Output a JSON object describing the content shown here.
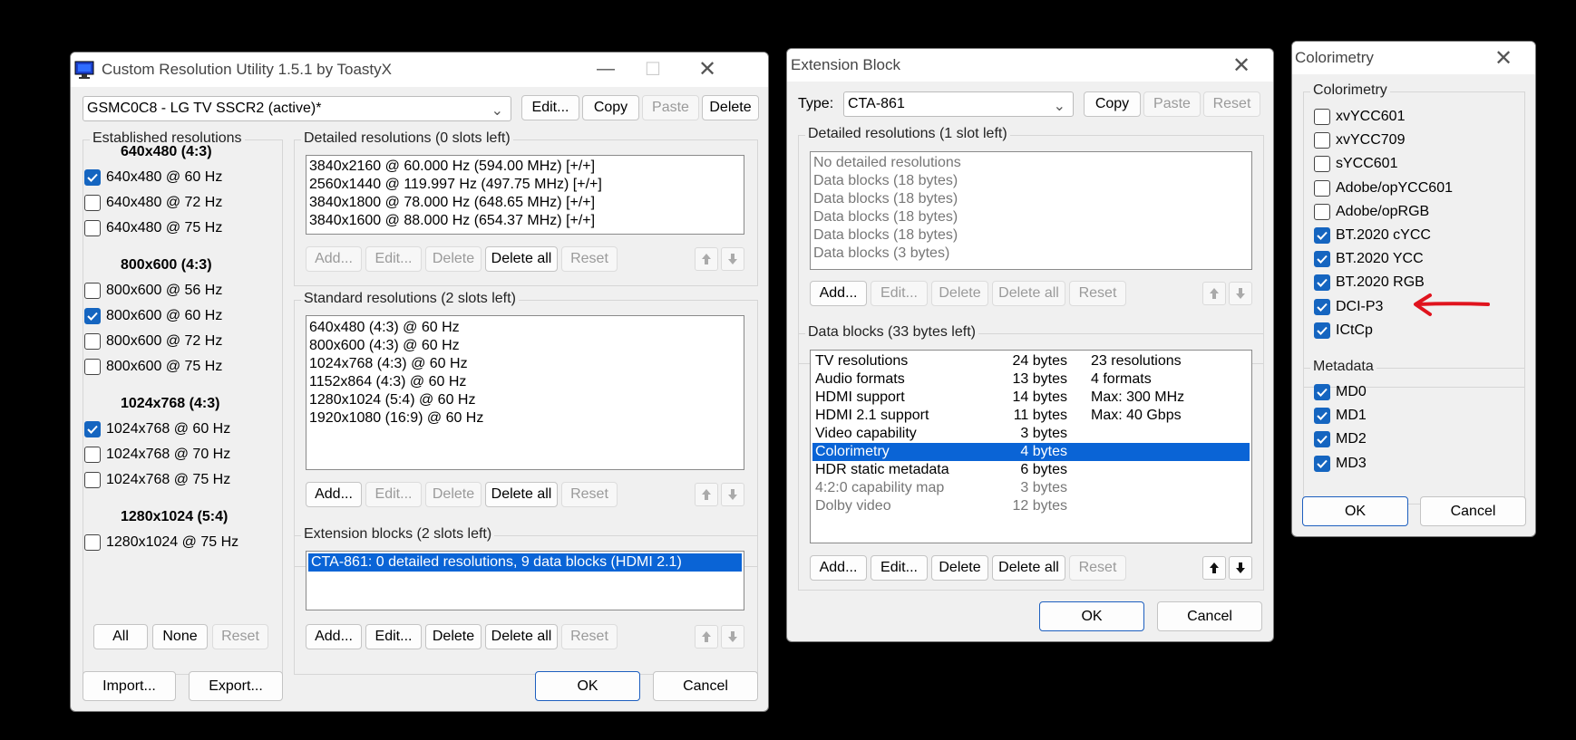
{
  "cru": {
    "title": "Custom Resolution Utility 1.5.1 by ToastyX",
    "display": "GSMC0C8 - LG TV SSCR2 (active)*",
    "top_buttons": {
      "edit": "Edit...",
      "copy": "Copy",
      "paste": "Paste",
      "delete": "Delete"
    },
    "established": {
      "label": "Established resolutions",
      "groups": [
        {
          "header": "640x480 (4:3)",
          "items": [
            {
              "label": "640x480 @ 60 Hz",
              "checked": true
            },
            {
              "label": "640x480 @ 72 Hz",
              "checked": false
            },
            {
              "label": "640x480 @ 75 Hz",
              "checked": false
            }
          ]
        },
        {
          "header": "800x600 (4:3)",
          "items": [
            {
              "label": "800x600 @ 56 Hz",
              "checked": false
            },
            {
              "label": "800x600 @ 60 Hz",
              "checked": true
            },
            {
              "label": "800x600 @ 72 Hz",
              "checked": false
            },
            {
              "label": "800x600 @ 75 Hz",
              "checked": false
            }
          ]
        },
        {
          "header": "1024x768 (4:3)",
          "items": [
            {
              "label": "1024x768 @ 60 Hz",
              "checked": true
            },
            {
              "label": "1024x768 @ 70 Hz",
              "checked": false
            },
            {
              "label": "1024x768 @ 75 Hz",
              "checked": false
            }
          ]
        },
        {
          "header": "1280x1024 (5:4)",
          "items": [
            {
              "label": "1280x1024 @ 75 Hz",
              "checked": false
            }
          ]
        }
      ],
      "buttons": {
        "all": "All",
        "none": "None",
        "reset": "Reset"
      }
    },
    "detailed": {
      "label": "Detailed resolutions (0 slots left)",
      "rows": [
        "3840x2160 @ 60.000 Hz (594.00 MHz) [+/+]",
        "2560x1440 @ 119.997 Hz (497.75 MHz) [+/+]",
        "3840x1800 @ 78.000 Hz (648.65 MHz) [+/+]",
        "3840x1600 @ 88.000 Hz (654.37 MHz) [+/+]"
      ]
    },
    "standard": {
      "label": "Standard resolutions (2 slots left)",
      "rows": [
        "640x480 (4:3) @ 60 Hz",
        "800x600 (4:3) @ 60 Hz",
        "1024x768 (4:3) @ 60 Hz",
        "1152x864 (4:3) @ 60 Hz",
        "1280x1024 (5:4) @ 60 Hz",
        "1920x1080 (16:9) @ 60 Hz"
      ]
    },
    "extension": {
      "label": "Extension blocks (2 slots left)",
      "rows": [
        "CTA-861: 0 detailed resolutions, 9 data blocks (HDMI 2.1)"
      ]
    },
    "list_buttons": {
      "add": "Add...",
      "edit": "Edit...",
      "delete": "Delete",
      "delete_all": "Delete all",
      "reset": "Reset"
    },
    "bottom": {
      "import": "Import...",
      "export": "Export...",
      "ok": "OK",
      "cancel": "Cancel"
    }
  },
  "ext": {
    "title": "Extension Block",
    "type_label": "Type:",
    "type_value": "CTA-861",
    "top_buttons": {
      "copy": "Copy",
      "paste": "Paste",
      "reset": "Reset"
    },
    "detailed": {
      "label": "Detailed resolutions (1 slot left)",
      "rows": [
        "No detailed resolutions",
        "Data blocks (18 bytes)",
        "Data blocks (18 bytes)",
        "Data blocks (18 bytes)",
        "Data blocks (18 bytes)",
        "Data blocks (3 bytes)"
      ]
    },
    "datablocks": {
      "label": "Data blocks (33 bytes left)",
      "rows": [
        {
          "name": "TV resolutions",
          "size": "24 bytes",
          "info": "23 resolutions"
        },
        {
          "name": "Audio formats",
          "size": "13 bytes",
          "info": "4 formats"
        },
        {
          "name": "HDMI support",
          "size": "14 bytes",
          "info": "Max: 300 MHz"
        },
        {
          "name": "HDMI 2.1 support",
          "size": "11 bytes",
          "info": "Max: 40 Gbps"
        },
        {
          "name": "Video capability",
          "size": "3 bytes",
          "info": ""
        },
        {
          "name": "Colorimetry",
          "size": "4 bytes",
          "info": ""
        },
        {
          "name": "HDR static metadata",
          "size": "6 bytes",
          "info": ""
        },
        {
          "name": "4:2:0 capability map",
          "size": "3 bytes",
          "info": ""
        },
        {
          "name": "Dolby video",
          "size": "12 bytes",
          "info": ""
        }
      ]
    },
    "list_buttons": {
      "add": "Add...",
      "edit": "Edit...",
      "delete": "Delete",
      "delete_all": "Delete all",
      "reset": "Reset"
    },
    "bottom": {
      "ok": "OK",
      "cancel": "Cancel"
    }
  },
  "colorimetry": {
    "title": "Colorimetry",
    "group_label": "Colorimetry",
    "items": [
      {
        "label": "xvYCC601",
        "checked": false
      },
      {
        "label": "xvYCC709",
        "checked": false
      },
      {
        "label": "sYCC601",
        "checked": false
      },
      {
        "label": "Adobe/opYCC601",
        "checked": false
      },
      {
        "label": "Adobe/opRGB",
        "checked": false
      },
      {
        "label": "BT.2020 cYCC",
        "checked": true
      },
      {
        "label": "BT.2020 YCC",
        "checked": true
      },
      {
        "label": "BT.2020 RGB",
        "checked": true
      },
      {
        "label": "DCI-P3",
        "checked": true
      },
      {
        "label": "ICtCp",
        "checked": true
      }
    ],
    "metadata_label": "Metadata",
    "metadata": [
      {
        "label": "MD0",
        "checked": true
      },
      {
        "label": "MD1",
        "checked": true
      },
      {
        "label": "MD2",
        "checked": true
      },
      {
        "label": "MD3",
        "checked": true
      }
    ],
    "bottom": {
      "ok": "OK",
      "cancel": "Cancel"
    }
  },
  "colors": {
    "accent": "#1565c0",
    "selection": "#0a64d6",
    "annotation_arrow": "#e0141e"
  }
}
